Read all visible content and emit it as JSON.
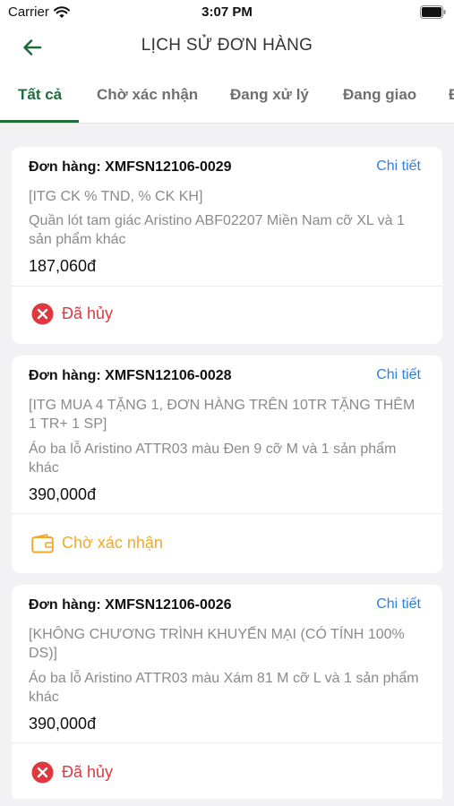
{
  "status_bar": {
    "carrier": "Carrier",
    "time": "3:07 PM"
  },
  "header": {
    "title": "LỊCH SỬ ĐƠN HÀNG"
  },
  "tabs": [
    {
      "label": "Tất cả",
      "active": true
    },
    {
      "label": "Chờ xác nhận",
      "active": false
    },
    {
      "label": "Đang xử lý",
      "active": false
    },
    {
      "label": "Đang giao",
      "active": false
    },
    {
      "label": "Đ",
      "active": false
    }
  ],
  "orders": [
    {
      "code": "Đơn hàng: XMFSN12106-0029",
      "detail_label": "Chi tiết",
      "promo": "[ITG CK % TND, % CK KH]",
      "product": "Quần lót tam giác Aristino ABF02207 Miền Nam cỡ XL và 1 sản phẩm khác",
      "price": "187,060đ",
      "status": {
        "label": "Đã hủy",
        "type": "cancelled",
        "color": "#e0383e"
      }
    },
    {
      "code": "Đơn hàng: XMFSN12106-0028",
      "detail_label": "Chi tiết",
      "promo": "[ITG MUA 4 TẶNG 1, ĐƠN HÀNG TRÊN 10TR TẶNG THÊM 1 TR+ 1 SP]",
      "product": "Áo ba lỗ Aristino ATTR03 màu Đen 9 cỡ M và 1 sản phẩm khác",
      "price": "390,000đ",
      "status": {
        "label": "Chờ xác nhận",
        "type": "pending",
        "color": "#f0a92a"
      }
    },
    {
      "code": "Đơn hàng: XMFSN12106-0026",
      "detail_label": "Chi tiết",
      "promo": "[KHÔNG CHƯƠNG TRÌNH KHUYẾN MẠI (CÓ TÍNH 100% DS)]",
      "product": "Áo ba lỗ Aristino ATTR03 màu Xám 81 M cỡ L và 1 sản phẩm khác",
      "price": "390,000đ",
      "status": {
        "label": "Đã hủy",
        "type": "cancelled",
        "color": "#e0383e"
      }
    }
  ],
  "colors": {
    "accent": "#1f6b3c",
    "link": "#2f7ee0",
    "cancelled": "#e0383e",
    "pending": "#f0a92a"
  }
}
